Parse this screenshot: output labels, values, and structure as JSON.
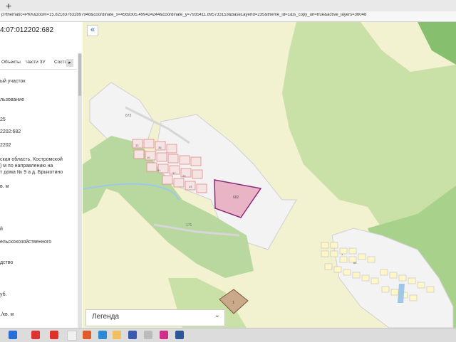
{
  "browser": {
    "new_tab_label": "+",
    "url": "p?thematic=PKK&zoom=15.821837632897948&coordinate_x=4569305.499424244&coordinate_y=7935411.895733153&baseLayerId=235&theme_id=1&is_copy_url=true&active_layers=36048"
  },
  "panel": {
    "cadastral_number": "4:07:012202:682",
    "tabs": [
      "Объекты",
      "Части ЗУ",
      "Состо"
    ],
    "tab_arrow": "▸",
    "rows": [
      "ый участок",
      "льзование",
      "25",
      "2202:682",
      "2202",
      "ская область, Костромской",
      ") м по направлению на",
      "т дома № 9 а д. Брыкотино",
      "в. м",
      "й",
      "ельскохозяйственного",
      "дство",
      "уб.",
      "./кв. м"
    ]
  },
  "map": {
    "collapse_label": "«",
    "legend_label": "Легенда",
    "legend_chevron": "⌄",
    "labels": {
      "road_672": "672",
      "road_171": "171",
      "parcel_682": "682",
      "plot_1": "1",
      "plot_10": "10",
      "block_41": "41",
      "block_37": "37",
      "block_39": "39",
      "block_43": "43",
      "block_33": "33",
      "block_36": "36",
      "block_68": "68",
      "block_1": "1"
    },
    "colors": {
      "field": "#f2f1d0",
      "forest": "#b8d8a0",
      "dark_forest": "#86c06e",
      "settlement": "#f3f3f3",
      "parcel_line": "#e08a8a",
      "selected_parcel_fill": "#e9b4c6",
      "selected_parcel_stroke": "#8c2a7a",
      "water": "#9ec8e6"
    }
  },
  "taskbar": {
    "icons": [
      "start-icon",
      "search-icon",
      "yandex-icon",
      "opera-icon",
      "chrome-icon",
      "edge-icon",
      "files-icon",
      "app-icon",
      "app2-icon",
      "word-icon"
    ]
  }
}
